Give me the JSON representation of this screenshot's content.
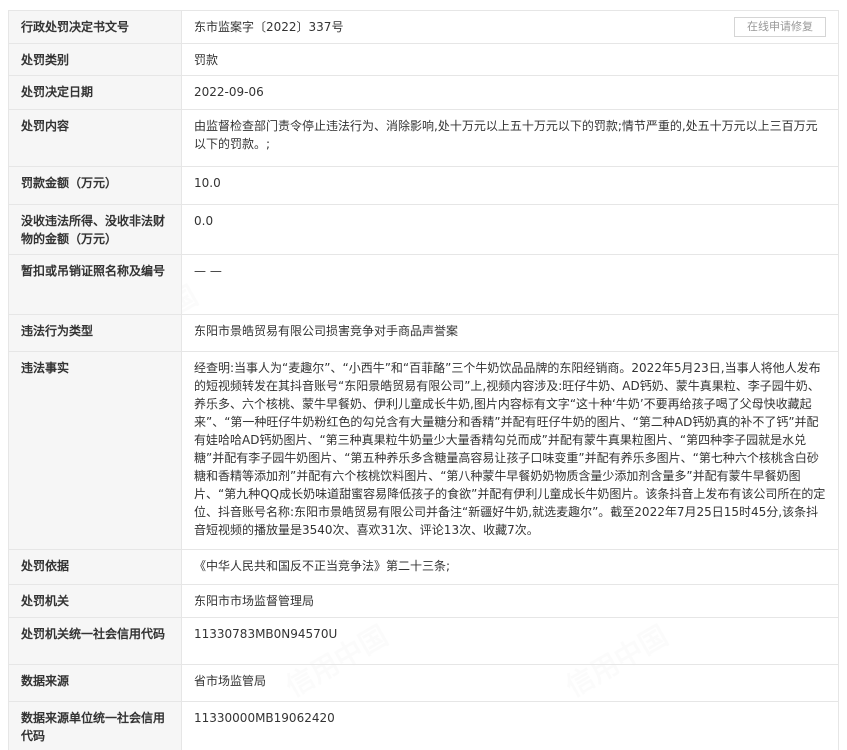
{
  "repair_button": "在线申请修复",
  "watermark": "信用中国",
  "rows": [
    {
      "label": "行政处罚决定书文号",
      "value": "东市监案字〔2022〕337号"
    },
    {
      "label": "处罚类别",
      "value": "罚款"
    },
    {
      "label": "处罚决定日期",
      "value": "2022-09-06"
    },
    {
      "label": "处罚内容",
      "value": "由监督检查部门责令停止违法行为、消除影响,处十万元以上五十万元以下的罚款;情节严重的,处五十万元以上三百万元以下的罚款。;"
    },
    {
      "label": "罚款金额（万元）",
      "value": "10.0"
    },
    {
      "label": "没收违法所得、没收非法财物的金额（万元）",
      "value": "0.0"
    },
    {
      "label": "暂扣或吊销证照名称及编号",
      "value": "— —"
    },
    {
      "label": "违法行为类型",
      "value": "东阳市景皓贸易有限公司损害竞争对手商品声誉案"
    },
    {
      "label": "违法事实",
      "value": "经查明:当事人为“麦趣尔”、“小西牛”和“百菲酪”三个牛奶饮品品牌的东阳经销商。2022年5月23日,当事人将他人发布的短视频转发在其抖音账号“东阳景皓贸易有限公司”上,视频内容涉及:旺仔牛奶、AD钙奶、蒙牛真果粒、李子园牛奶、养乐多、六个核桃、蒙牛早餐奶、伊利儿童成长牛奶,图片内容标有文字“这十种‘牛奶’不要再给孩子喝了父母快收藏起来”、“第一种旺仔牛奶粉红色的勾兑含有大量糖分和香精”并配有旺仔牛奶的图片、“第二种AD钙奶真的补不了钙”并配有娃哈哈AD钙奶图片、“第三种真果粒牛奶量少大量香精勾兑而成”并配有蒙牛真果粒图片、“第四种李子园就是水兑糖”并配有李子园牛奶图片、“第五种养乐多含糖量高容易让孩子口味变重”并配有养乐多图片、“第七种六个核桃含白砂糖和香精等添加剂”并配有六个核桃饮料图片、“第八种蒙牛早餐奶奶物质含量少添加剂含量多”并配有蒙牛早餐奶图片、“第九种QQ成长奶味道甜蜜容易降低孩子的食欲”并配有伊利儿童成长牛奶图片。该条抖音上发布有该公司所在的定位、抖音账号名称:东阳市景皓贸易有限公司并备注“新疆好牛奶,就选麦趣尔”。截至2022年7月25日15时45分,该条抖音短视频的播放量是3540次、喜欢31次、评论13次、收藏7次。"
    },
    {
      "label": "处罚依据",
      "value": "《中华人民共和国反不正当竞争法》第二十三条;"
    },
    {
      "label": "处罚机关",
      "value": "东阳市市场监督管理局"
    },
    {
      "label": "处罚机关统一社会信用代码",
      "value": "11330783MB0N94570U"
    },
    {
      "label": "数据来源",
      "value": "省市场监管局"
    },
    {
      "label": "数据来源单位统一社会信用代码",
      "value": "11330000MB19062420"
    }
  ]
}
